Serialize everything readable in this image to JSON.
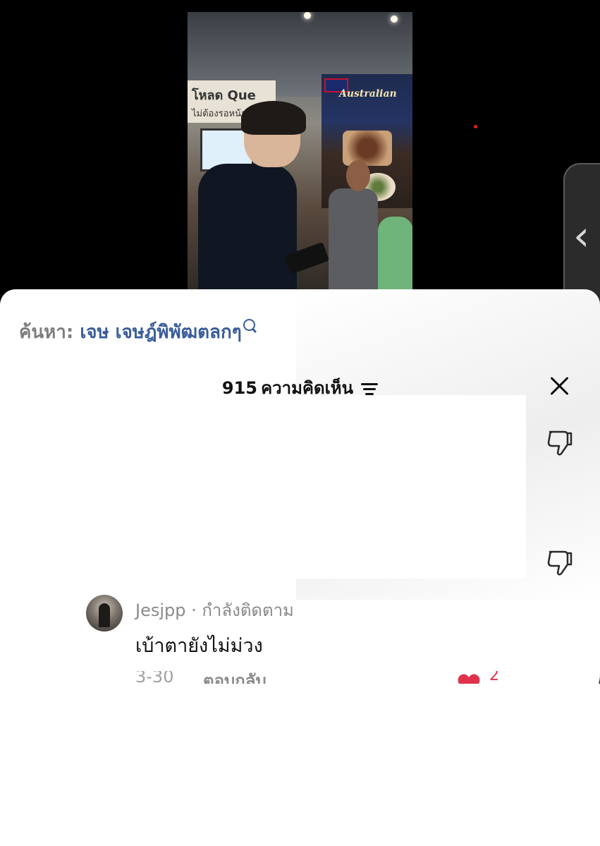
{
  "search": {
    "label": "ค้นหา:",
    "query": "เจษ เจษฎ์พิพัฒตลกๆ"
  },
  "comments_header": {
    "count": "915",
    "label": "ความคิดเห็น"
  },
  "comment": {
    "username": "Jesjpp",
    "status": "· กำลังติดตาม",
    "text": "เบ้าตายังไม่ม่วง",
    "time": "3-30",
    "reply_label": "ตอบกลับ",
    "likes": "2"
  },
  "colors": {
    "search_query": "#3a5d9a",
    "like_heart": "#e0324c",
    "overlay_background": "#000000"
  },
  "icons": {
    "search": "search-icon",
    "filter": "sort-lines-icon",
    "close": "close-x-icon",
    "dislike": "thumbs-down-icon",
    "like": "heart-icon",
    "panel_toggle": "chevron-left-icon"
  }
}
